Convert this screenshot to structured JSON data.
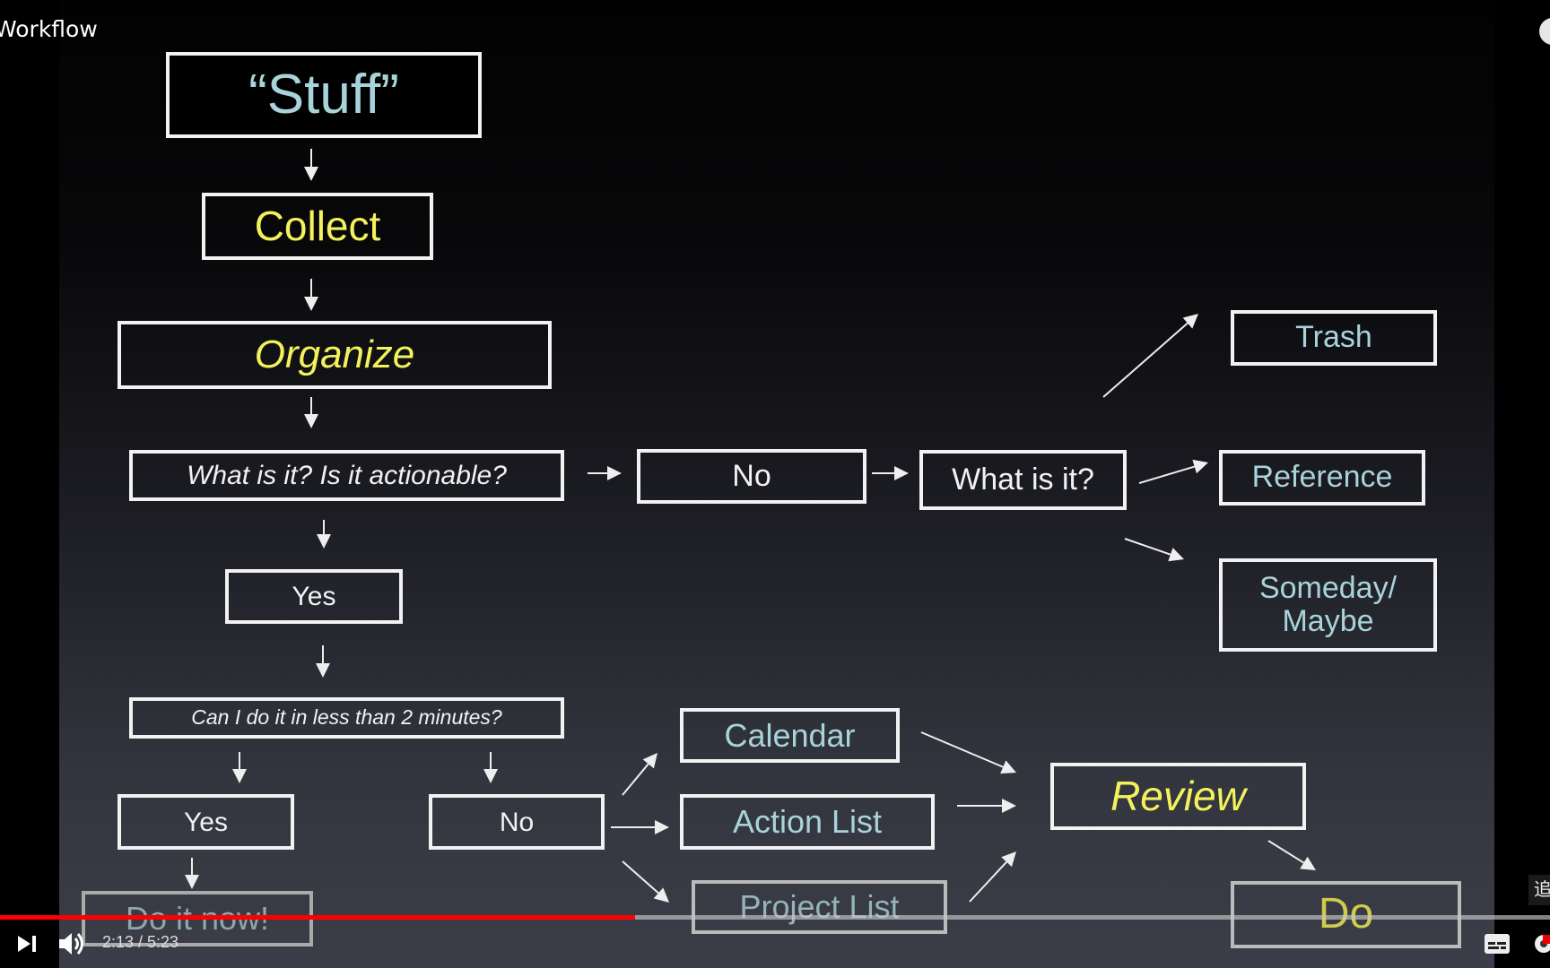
{
  "video": {
    "title": "Workflow",
    "current_time": "2:13",
    "duration": "5:23",
    "time_display": "2:13 / 5:23",
    "progress_fraction": 0.41,
    "tooltip_glyph": "追"
  },
  "colors": {
    "box_text": "#a9d3da",
    "highlight_text": "#f3f15c",
    "progress": "#ff0000"
  },
  "flowchart": {
    "stuff": "“Stuff”",
    "collect": "Collect",
    "organize": "Organize",
    "actionable": "What is it?  Is it actionable?",
    "no": "No",
    "what_is_it": "What is it?",
    "trash": "Trash",
    "reference": "Reference",
    "someday": "Someday/",
    "maybe": "Maybe",
    "yes": "Yes",
    "two_minutes": "Can I do it in less than 2 minutes?",
    "yes2": "Yes",
    "no2": "No",
    "do_it_now": "Do it now!",
    "calendar": "Calendar",
    "action_list": "Action List",
    "project_list": "Project List",
    "review": "Review",
    "do": "Do"
  },
  "controls": {
    "icons": [
      "next-icon",
      "volume-icon",
      "captions-icon",
      "settings-icon"
    ]
  }
}
